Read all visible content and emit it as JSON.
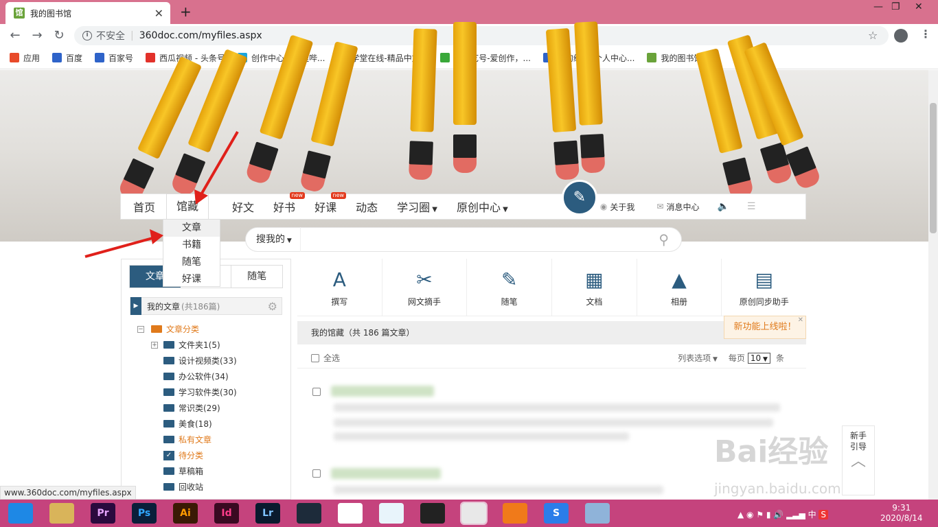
{
  "browser": {
    "tab_title": "我的图书馆",
    "tab_favicon": "馆",
    "new_tab": "+",
    "url_security": "不安全",
    "url": "360doc.com/myfiles.aspx",
    "bookmarks": [
      {
        "label": "应用",
        "color": "#e84a2a"
      },
      {
        "label": "百度",
        "color": "#2e63c9"
      },
      {
        "label": "百家号",
        "color": "#2e63c9"
      },
      {
        "label": "西瓜视频 - 头条号",
        "color": "#e2312a"
      },
      {
        "label": "创作中心 - 哔哩哔...",
        "color": "#1aa5e0"
      },
      {
        "label": "学堂在线-精品中文...",
        "color": "#d1301f"
      },
      {
        "label": "爱奇艺号-爱创作，...",
        "color": "#3aa83a"
      },
      {
        "label": "我的经验_个人中心...",
        "color": "#2e63c9"
      },
      {
        "label": "我的图书馆",
        "color": "#6aa33a"
      }
    ]
  },
  "nav": {
    "items": [
      "首页",
      "馆藏",
      "好文",
      "好书",
      "好课",
      "动态",
      "学习圈",
      "原创中心"
    ],
    "new_badge": "new",
    "about": "关于我",
    "messages": "消息中心"
  },
  "dropdown": [
    "文章",
    "书籍",
    "随笔",
    "好课"
  ],
  "search": {
    "scope": "搜我的"
  },
  "left": {
    "tabs": [
      "文章",
      "",
      "随笔"
    ],
    "my_articles": "我的文章",
    "my_count": "(共186篇)",
    "tree": [
      {
        "label": "文章分类",
        "style": "root"
      },
      {
        "label": "文件夹1(5)",
        "style": "folder"
      },
      {
        "label": "设计视频类(33)",
        "style": "folder"
      },
      {
        "label": "办公软件(34)",
        "style": "folder"
      },
      {
        "label": "学习软件类(30)",
        "style": "folder"
      },
      {
        "label": "常识类(29)",
        "style": "folder"
      },
      {
        "label": "美食(18)",
        "style": "folder"
      },
      {
        "label": "私有文章",
        "style": "orange"
      },
      {
        "label": "待分类",
        "style": "check"
      },
      {
        "label": "草稿箱",
        "style": "folder"
      },
      {
        "label": "回收站",
        "style": "folder"
      }
    ]
  },
  "tools": [
    {
      "label": "撰写",
      "icon": "compose-icon"
    },
    {
      "label": "网文摘手",
      "icon": "scissors-icon"
    },
    {
      "label": "随笔",
      "icon": "pen-icon"
    },
    {
      "label": "文档",
      "icon": "document-icon"
    },
    {
      "label": "相册",
      "icon": "album-icon"
    },
    {
      "label": "原创同步助手",
      "icon": "sync-doc-icon"
    }
  ],
  "tip": "新功能上线啦！",
  "section_title": "我的馆藏（共 186 篇文章）",
  "options": {
    "select_all": "全选",
    "list_options": "列表选项",
    "per_page": "每页",
    "page_size": "10",
    "unit": "条"
  },
  "guide": [
    "新手",
    "引导"
  ],
  "watermark": {
    "brand": "Bai经验",
    "site": "jingyan.baidu.com"
  },
  "status_url": "www.360doc.com/myfiles.aspx",
  "clock": {
    "time": "9:31",
    "date": "2020/8/14"
  },
  "tray_ime": "中",
  "taskbar": [
    {
      "label": "",
      "color": "#1e88e5"
    },
    {
      "label": "",
      "color": "#d9b45a"
    },
    {
      "label": "Pr",
      "color": "#2a0a3e"
    },
    {
      "label": "Ps",
      "color": "#0a1f3a"
    },
    {
      "label": "Ai",
      "color": "#3a1a05"
    },
    {
      "label": "Id",
      "color": "#3a0a22"
    },
    {
      "label": "Lr",
      "color": "#0a1a2e"
    },
    {
      "label": "",
      "color": "#1d2b3a"
    },
    {
      "label": "",
      "color": "#ffffff"
    },
    {
      "label": "",
      "color": "#e8f4fb"
    },
    {
      "label": "",
      "color": "#222222"
    },
    {
      "label": "",
      "color": "#e8e8e8"
    },
    {
      "label": "",
      "color": "#f07a1a"
    },
    {
      "label": "S",
      "color": "#2b7de9"
    },
    {
      "label": "",
      "color": "#8fb3d9"
    }
  ]
}
